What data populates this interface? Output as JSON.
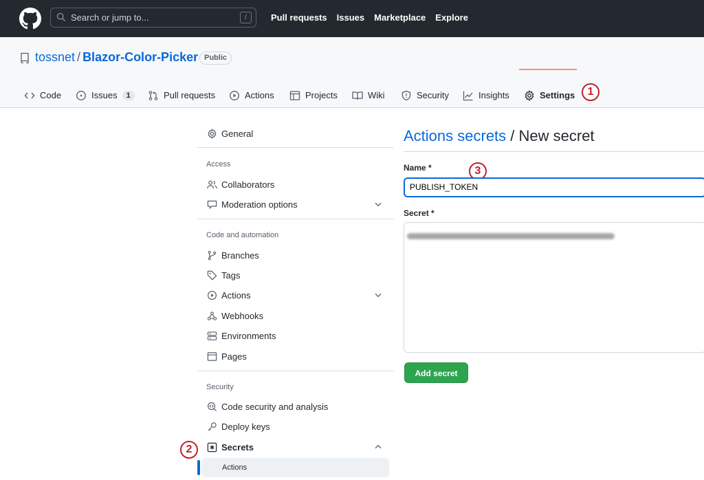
{
  "header": {
    "search_placeholder": "Search or jump to...",
    "search_kbd": "/",
    "nav": [
      "Pull requests",
      "Issues",
      "Marketplace",
      "Explore"
    ]
  },
  "repo": {
    "owner": "tossnet",
    "separator": "/",
    "name": "Blazor-Color-Picker",
    "visibility": "Public"
  },
  "tabs": [
    {
      "label": "Code",
      "icon": "code-icon"
    },
    {
      "label": "Issues",
      "icon": "issue-icon",
      "count": "1"
    },
    {
      "label": "Pull requests",
      "icon": "pull-request-icon"
    },
    {
      "label": "Actions",
      "icon": "play-icon"
    },
    {
      "label": "Projects",
      "icon": "table-icon"
    },
    {
      "label": "Wiki",
      "icon": "book-icon"
    },
    {
      "label": "Security",
      "icon": "shield-icon"
    },
    {
      "label": "Insights",
      "icon": "graph-icon"
    },
    {
      "label": "Settings",
      "icon": "gear-icon",
      "selected": true
    }
  ],
  "callouts": [
    "1",
    "2",
    "3"
  ],
  "sidebar": {
    "general": "General",
    "access_heading": "Access",
    "collaborators": "Collaborators",
    "moderation": "Moderation options",
    "code_automation_heading": "Code and automation",
    "branches": "Branches",
    "tags": "Tags",
    "actions": "Actions",
    "webhooks": "Webhooks",
    "environments": "Environments",
    "pages": "Pages",
    "security_heading": "Security",
    "code_security": "Code security and analysis",
    "deploy_keys": "Deploy keys",
    "secrets": "Secrets",
    "secrets_actions": "Actions"
  },
  "main": {
    "title_link": "Actions secrets",
    "title_rest": " / New secret",
    "name_label": "Name *",
    "name_value": "PUBLISH_TOKEN",
    "secret_label": "Secret *",
    "add_button": "Add secret"
  },
  "colors": {
    "header_bg": "#24292f",
    "link": "#0969da",
    "primary_button": "#2da44e",
    "tab_underline": "#fd8c73",
    "callout": "#c0202a"
  }
}
